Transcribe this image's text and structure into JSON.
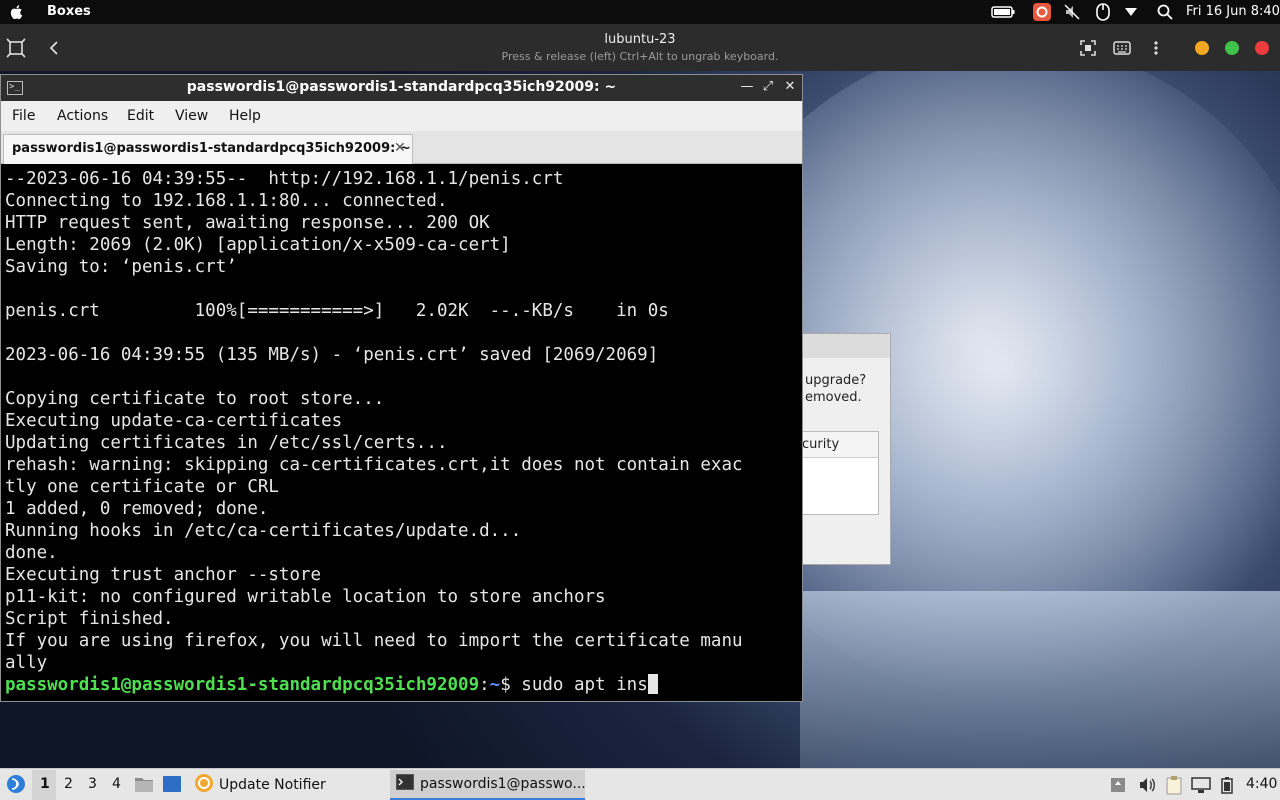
{
  "topbar": {
    "app_name": "Boxes",
    "clock": "Fri 16 Jun  8:40",
    "icons": [
      "apple-icon",
      "battery-icon",
      "app-indicator-icon",
      "mic-muted-icon",
      "mouse-icon",
      "dropdown-icon",
      "search-icon"
    ]
  },
  "boxes": {
    "vm_title": "lubuntu-23",
    "vm_subtitle": "Press & release (left) Ctrl+Alt to ungrab keyboard.",
    "icons": [
      "fullscreen-icon",
      "back-icon",
      "screenshot-icon",
      "keyboard-icon",
      "menu-icon"
    ],
    "dot_colors": [
      "#f5a623",
      "#3fc24a",
      "#ec3c3c"
    ]
  },
  "bg_dialog": {
    "line1": "upgrade?",
    "line2": "emoved.",
    "box_header": "curity"
  },
  "terminal": {
    "window_title": "passwordis1@passwordis1-standardpcq35ich92009: ~",
    "menu": [
      "File",
      "Actions",
      "Edit",
      "View",
      "Help"
    ],
    "tab_label": "passwordis1@passwordis1-standardpcq35ich92009: ~",
    "lines": [
      "--2023-06-16 04:39:55--  http://192.168.1.1/penis.crt",
      "Connecting to 192.168.1.1:80... connected.",
      "HTTP request sent, awaiting response... 200 OK",
      "Length: 2069 (2.0K) [application/x-x509-ca-cert]",
      "Saving to: ‘penis.crt’",
      "",
      "penis.crt         100%[===========>]   2.02K  --.-KB/s    in 0s",
      "",
      "2023-06-16 04:39:55 (135 MB/s) - ‘penis.crt’ saved [2069/2069]",
      "",
      "Copying certificate to root store...",
      "Executing update-ca-certificates",
      "Updating certificates in /etc/ssl/certs...",
      "rehash: warning: skipping ca-certificates.crt,it does not contain exac",
      "tly one certificate or CRL",
      "1 added, 0 removed; done.",
      "Running hooks in /etc/ca-certificates/update.d...",
      "done.",
      "Executing trust anchor --store",
      "p11-kit: no configured writable location to store anchors",
      "Script finished.",
      "If you are using firefox, you will need to import the certificate manu",
      "ally"
    ],
    "prompt_user": "passwordis1@passwordis1-standardpcq35ich92009",
    "prompt_sep": ":",
    "prompt_dir": "~",
    "prompt_symbol": "$ ",
    "command": "sudo apt ins"
  },
  "panel": {
    "workspaces": [
      "1",
      "2",
      "3",
      "4"
    ],
    "tasks": [
      {
        "label": "Update Notifier",
        "icon": "update-notifier-icon"
      },
      {
        "label": "passwordis1@passwo...",
        "icon": "terminal-icon"
      }
    ],
    "clock": "4:40",
    "tray_icons": [
      "removable-media-icon",
      "volume-icon",
      "clipboard-icon",
      "network-icon",
      "battery-icon"
    ]
  }
}
